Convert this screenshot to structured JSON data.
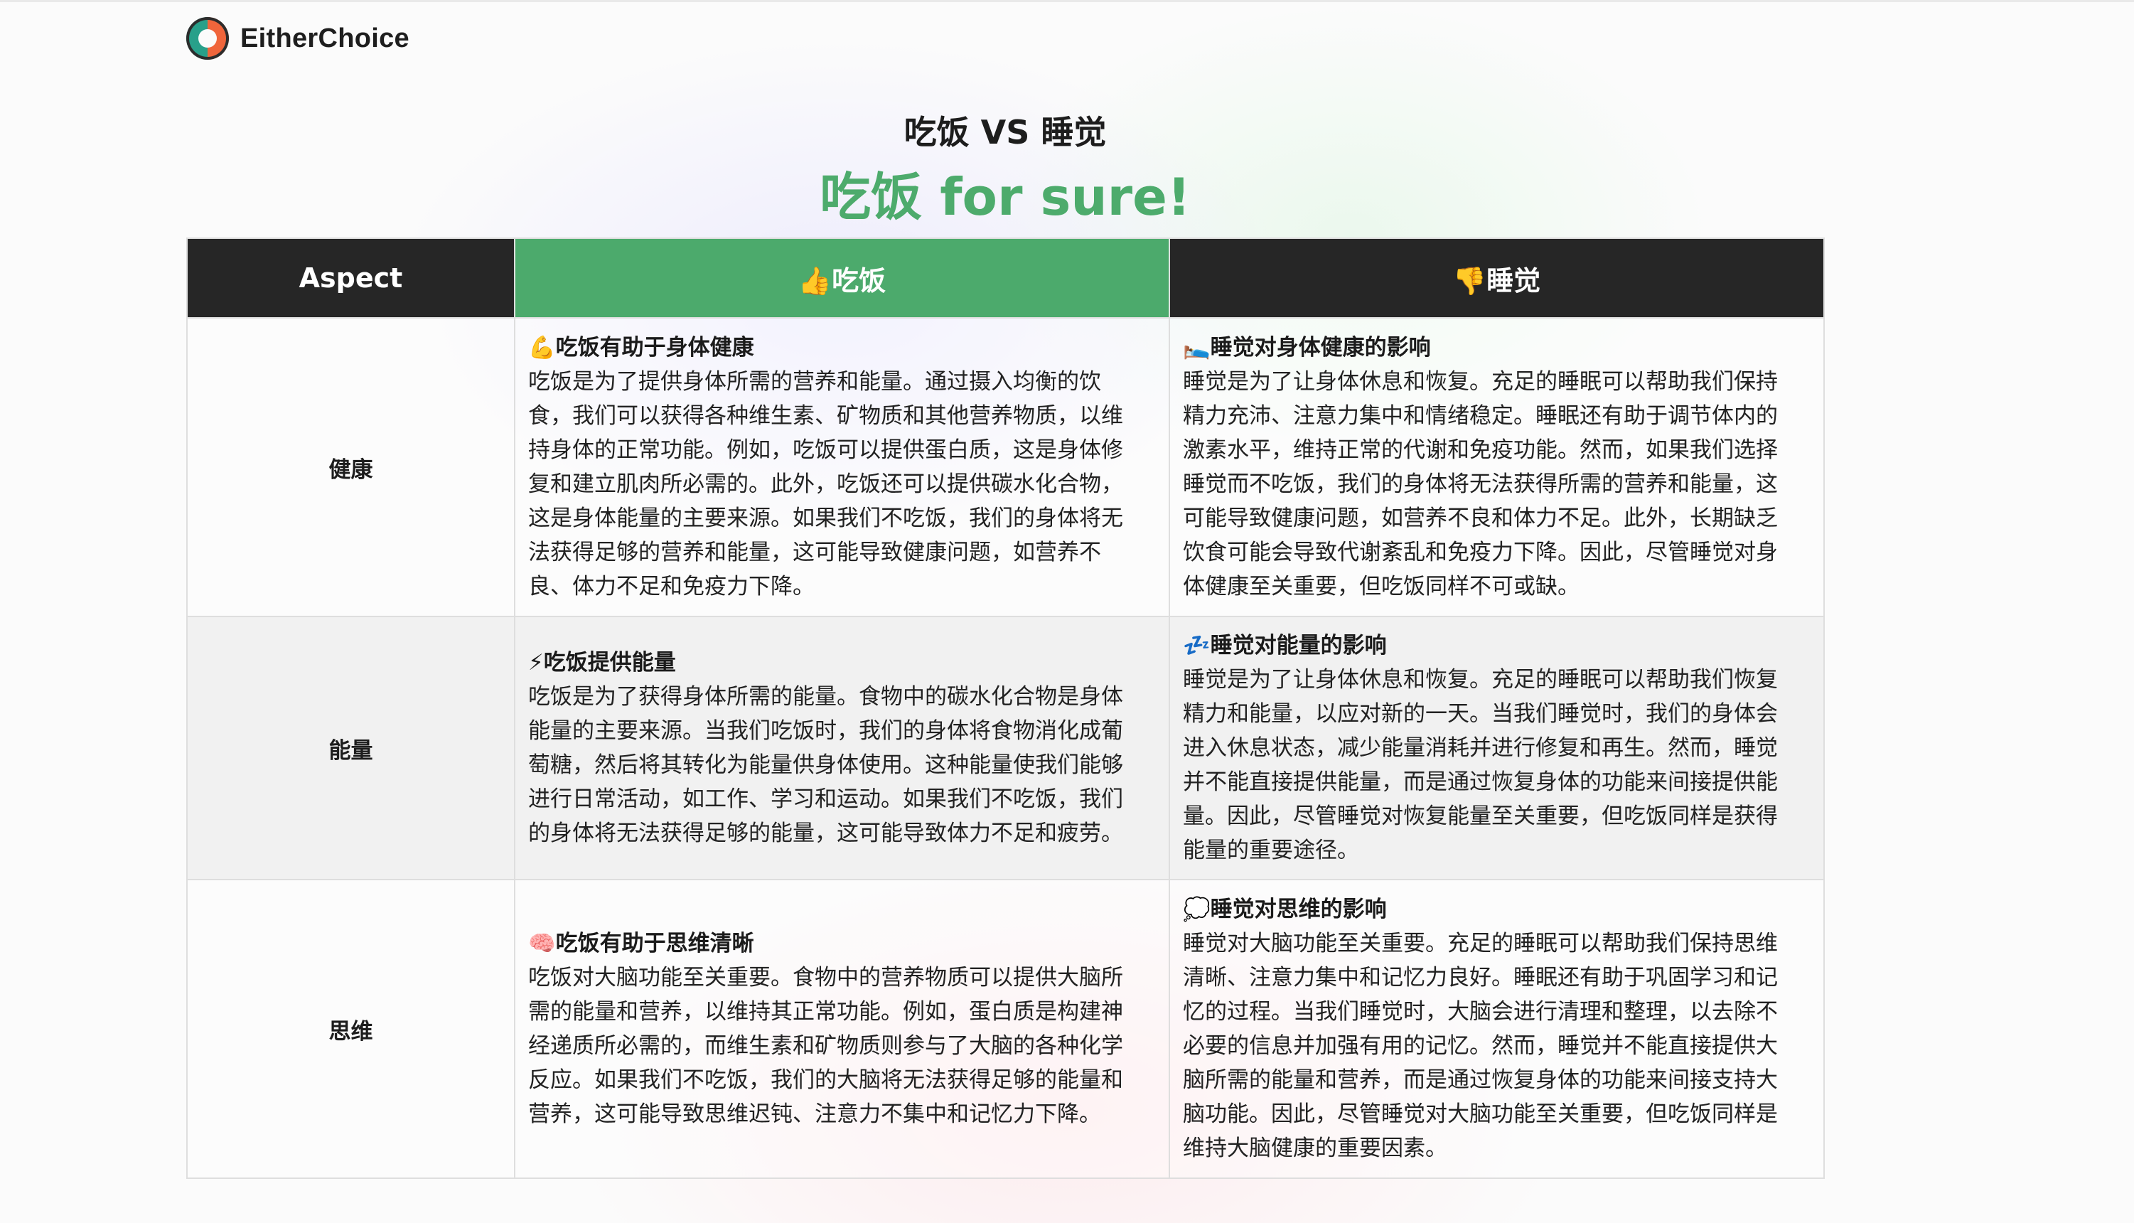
{
  "brand": {
    "name": "EitherChoice"
  },
  "comparison": {
    "vs_title": "吃饭 VS 睡觉",
    "verdict": "吃饭 for sure!"
  },
  "table": {
    "header": {
      "aspect": "Aspect",
      "a": "👍吃饭",
      "b": "👎睡觉"
    },
    "rows": [
      {
        "aspect": "健康",
        "a_title": "💪吃饭有助于身体健康",
        "a_body": "吃饭是为了提供身体所需的营养和能量。通过摄入均衡的饮食，我们可以获得各种维生素、矿物质和其他营养物质，以维持身体的正常功能。例如，吃饭可以提供蛋白质，这是身体修复和建立肌肉所必需的。此外，吃饭还可以提供碳水化合物，这是身体能量的主要来源。如果我们不吃饭，我们的身体将无法获得足够的营养和能量，这可能导致健康问题，如营养不良、体力不足和免疫力下降。",
        "b_title": "🛌睡觉对身体健康的影响",
        "b_body": "睡觉是为了让身体休息和恢复。充足的睡眠可以帮助我们保持精力充沛、注意力集中和情绪稳定。睡眠还有助于调节体内的激素水平，维持正常的代谢和免疫功能。然而，如果我们选择睡觉而不吃饭，我们的身体将无法获得所需的营养和能量，这可能导致健康问题，如营养不良和体力不足。此外，长期缺乏饮食可能会导致代谢紊乱和免疫力下降。因此，尽管睡觉对身体健康至关重要，但吃饭同样不可或缺。"
      },
      {
        "aspect": "能量",
        "a_title": "⚡吃饭提供能量",
        "a_body": "吃饭是为了获得身体所需的能量。食物中的碳水化合物是身体能量的主要来源。当我们吃饭时，我们的身体将食物消化成葡萄糖，然后将其转化为能量供身体使用。这种能量使我们能够进行日常活动，如工作、学习和运动。如果我们不吃饭，我们的身体将无法获得足够的能量，这可能导致体力不足和疲劳。",
        "b_title": "💤睡觉对能量的影响",
        "b_body": "睡觉是为了让身体休息和恢复。充足的睡眠可以帮助我们恢复精力和能量，以应对新的一天。当我们睡觉时，我们的身体会进入休息状态，减少能量消耗并进行修复和再生。然而，睡觉并不能直接提供能量，而是通过恢复身体的功能来间接提供能量。因此，尽管睡觉对恢复能量至关重要，但吃饭同样是获得能量的重要途径。"
      },
      {
        "aspect": "思维",
        "a_title": "🧠吃饭有助于思维清晰",
        "a_body": "吃饭对大脑功能至关重要。食物中的营养物质可以提供大脑所需的能量和营养，以维持其正常功能。例如，蛋白质是构建神经递质所必需的，而维生素和矿物质则参与了大脑的各种化学反应。如果我们不吃饭，我们的大脑将无法获得足够的能量和营养，这可能导致思维迟钝、注意力不集中和记忆力下降。",
        "b_title": "💭睡觉对思维的影响",
        "b_body": "睡觉对大脑功能至关重要。充足的睡眠可以帮助我们保持思维清晰、注意力集中和记忆力良好。睡眠还有助于巩固学习和记忆的过程。当我们睡觉时，大脑会进行清理和整理，以去除不必要的信息并加强有用的记忆。然而，睡觉并不能直接提供大脑所需的能量和营养，而是通过恢复身体的功能来间接支持大脑功能。因此，尽管睡觉对大脑功能至关重要，但吃饭同样是维持大脑健康的重要因素。"
      }
    ]
  }
}
